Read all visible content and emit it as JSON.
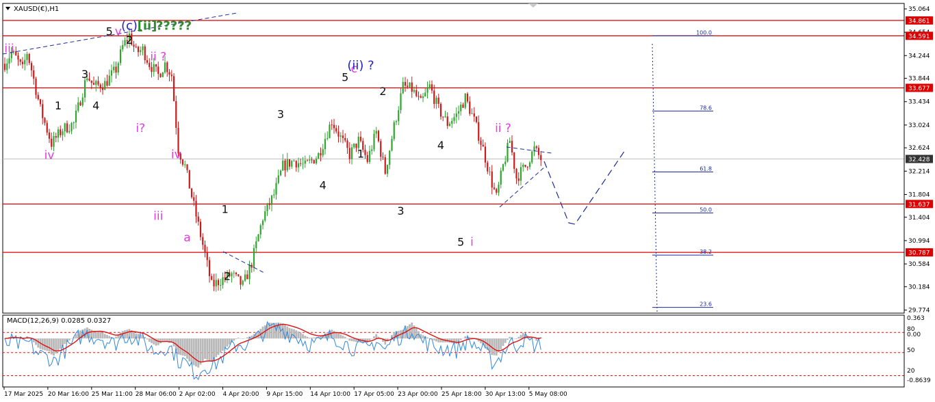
{
  "symbol_label": "XAUSD(€),H1",
  "macd_label": "MACD(12,26,9) 0.0285 0.0327",
  "colors": {
    "level_line": "#dd0000",
    "candle_up": "#2ea52e",
    "candle_down": "#cc1a1a",
    "macd_line": "#2e86de",
    "signal_line": "#dd1111",
    "histogram": "#b8b8b8",
    "projection": "#1a2a9a",
    "fib_line": "#1a2a9a",
    "price_box": "#dd0000",
    "current_box": "#333333",
    "magenta": "#e23ce2",
    "black": "#111111",
    "blue": "#2222cc",
    "green": "#2e8b2e"
  },
  "chart_data": {
    "type": "candlestick",
    "y_range": [
      29.72,
      35.16
    ],
    "price_ticks": [
      "35.064",
      "34.654",
      "34.244",
      "33.844",
      "33.434",
      "33.024",
      "32.624",
      "32.214",
      "31.804",
      "31.404",
      "30.994",
      "30.584",
      "30.184",
      "29.774"
    ],
    "price_tick_values": [
      35.064,
      34.654,
      34.244,
      33.844,
      33.434,
      33.024,
      32.624,
      32.214,
      31.804,
      31.404,
      30.994,
      30.584,
      30.184,
      29.774
    ],
    "time_labels": [
      "17 Mar 2025",
      "20 Mar 16:00",
      "25 Mar 11:00",
      "28 Mar 06:00",
      "2 Apr 02:00",
      "4 Apr 20:00",
      "9 Apr 15:00",
      "14 Apr 10:00",
      "17 Apr 05:00",
      "23 Apr 00:00",
      "25 Apr 18:00",
      "30 Apr 13:00",
      "5 May 08:00"
    ],
    "horizontal_levels": [
      {
        "label": "34.861",
        "value": 34.861
      },
      {
        "label": "34.591",
        "value": 34.591
      },
      {
        "label": "33.677",
        "value": 33.677
      },
      {
        "label": "31.637",
        "value": 31.637
      },
      {
        "label": "30.787",
        "value": 30.787
      }
    ],
    "current_price": {
      "label": "32.428",
      "value": 32.428
    },
    "price_path": [
      [
        0,
        34.1
      ],
      [
        3,
        34.3
      ],
      [
        5,
        34.2
      ],
      [
        8,
        34.0
      ],
      [
        10,
        34.3
      ],
      [
        12,
        34.0
      ],
      [
        16,
        33.3
      ],
      [
        21,
        32.7
      ],
      [
        26,
        32.95
      ],
      [
        31,
        33.05
      ],
      [
        37,
        33.9
      ],
      [
        40,
        33.7
      ],
      [
        45,
        33.75
      ],
      [
        50,
        34.0
      ],
      [
        53,
        34.4
      ],
      [
        56,
        34.6
      ],
      [
        59,
        34.3
      ],
      [
        62,
        34.35
      ],
      [
        65,
        34.1
      ],
      [
        69,
        33.9
      ],
      [
        72,
        34.1
      ],
      [
        75,
        33.9
      ],
      [
        78,
        32.6
      ],
      [
        81,
        32.3
      ],
      [
        85,
        31.6
      ],
      [
        90,
        30.75
      ],
      [
        93,
        30.2
      ],
      [
        97,
        30.3
      ],
      [
        102,
        30.4
      ],
      [
        107,
        30.2
      ],
      [
        111,
        30.6
      ],
      [
        116,
        31.4
      ],
      [
        121,
        31.8
      ],
      [
        125,
        32.3
      ],
      [
        130,
        32.4
      ],
      [
        135,
        32.3
      ],
      [
        141,
        32.5
      ],
      [
        147,
        33.1
      ],
      [
        151,
        32.8
      ],
      [
        155,
        32.5
      ],
      [
        159,
        32.75
      ],
      [
        163,
        32.4
      ],
      [
        167,
        32.9
      ],
      [
        171,
        32.2
      ],
      [
        175,
        33.0
      ],
      [
        179,
        33.7
      ],
      [
        183,
        33.65
      ],
      [
        187,
        33.4
      ],
      [
        191,
        33.7
      ],
      [
        195,
        33.3
      ],
      [
        199,
        33.05
      ],
      [
        203,
        33.2
      ],
      [
        207,
        33.5
      ],
      [
        211,
        33.1
      ],
      [
        215,
        32.6
      ],
      [
        219,
        32.0
      ],
      [
        221,
        31.75
      ],
      [
        224,
        32.3
      ],
      [
        227,
        32.75
      ],
      [
        230,
        32.1
      ],
      [
        234,
        32.3
      ],
      [
        238,
        32.6
      ],
      [
        241,
        32.43
      ]
    ],
    "macd_ticks": [
      "0.363",
      "0.00",
      "20",
      "-0.8639"
    ],
    "rsi_ticks": [
      "80",
      "50"
    ],
    "macd_range": [
      -0.95,
      0.45
    ],
    "macd_dashed_levels": [
      0.12,
      -0.28,
      -0.74
    ],
    "wave_labels": [
      {
        "text": "iii",
        "color": "magenta",
        "price": 34.3,
        "bar": 2,
        "size": 17
      },
      {
        "text": "1",
        "color": "black",
        "price": 33.3,
        "bar": 24,
        "size": 16
      },
      {
        "text": "iv",
        "color": "magenta",
        "price": 32.43,
        "bar": 20,
        "size": 17
      },
      {
        "text": "3",
        "color": "black",
        "price": 33.85,
        "bar": 36,
        "size": 16
      },
      {
        "text": "4",
        "color": "black",
        "price": 33.3,
        "bar": 41,
        "size": 16
      },
      {
        "text": "5",
        "color": "black",
        "price": 34.6,
        "bar": 47,
        "size": 16
      },
      {
        "text": "v",
        "color": "magenta",
        "price": 34.6,
        "bar": 51,
        "size": 17
      },
      {
        "text": "2",
        "color": "black",
        "price": 34.45,
        "bar": 56,
        "size": 16
      },
      {
        "text": "(c)",
        "color": "blue",
        "price": 34.7,
        "bar": 56,
        "size": 18
      },
      {
        "text": "[ii]",
        "color": "green",
        "price": 34.7,
        "bar": 64,
        "size": 18
      },
      {
        "text": "?????",
        "color": "green",
        "price": 34.7,
        "bar": 76,
        "size": 18
      },
      {
        "text": "ii ?",
        "color": "magenta",
        "price": 34.16,
        "bar": 69,
        "size": 17
      },
      {
        "text": "i?",
        "color": "magenta",
        "price": 32.9,
        "bar": 61,
        "size": 17
      },
      {
        "text": "iv",
        "color": "magenta",
        "price": 32.44,
        "bar": 77,
        "size": 17
      },
      {
        "text": "iii",
        "color": "magenta",
        "price": 31.36,
        "bar": 69,
        "size": 17
      },
      {
        "text": "a",
        "color": "magenta",
        "price": 30.98,
        "bar": 82,
        "size": 17
      },
      {
        "text": "1",
        "color": "black",
        "price": 31.48,
        "bar": 99,
        "size": 16
      },
      {
        "text": "2",
        "color": "black",
        "price": 30.3,
        "bar": 100,
        "size": 16
      },
      {
        "text": "3",
        "color": "black",
        "price": 33.15,
        "bar": 124,
        "size": 16
      },
      {
        "text": "4",
        "color": "black",
        "price": 31.9,
        "bar": 143,
        "size": 16
      },
      {
        "text": "5",
        "color": "black",
        "price": 33.8,
        "bar": 153,
        "size": 16
      },
      {
        "text": "c",
        "color": "magenta",
        "price": 33.95,
        "bar": 157,
        "size": 17
      },
      {
        "text": "(ii) ?",
        "color": "blue",
        "price": 34.0,
        "bar": 160,
        "size": 18
      },
      {
        "text": "2",
        "color": "black",
        "price": 33.55,
        "bar": 170,
        "size": 16
      },
      {
        "text": "1",
        "color": "black",
        "price": 32.45,
        "bar": 160,
        "size": 16
      },
      {
        "text": "4",
        "color": "black",
        "price": 32.6,
        "bar": 196,
        "size": 16
      },
      {
        "text": "3",
        "color": "black",
        "price": 31.45,
        "bar": 178,
        "size": 16
      },
      {
        "text": "5",
        "color": "black",
        "price": 30.9,
        "bar": 205,
        "size": 16
      },
      {
        "text": "i",
        "color": "magenta",
        "price": 30.9,
        "bar": 210,
        "size": 17
      },
      {
        "text": "ii ?",
        "color": "magenta",
        "price": 32.9,
        "bar": 224,
        "size": 17
      }
    ],
    "fibonacci": {
      "labels": [
        "100.0",
        "78.6",
        "61.8",
        "50.0",
        "38.2",
        "23.6"
      ],
      "values": [
        34.591,
        33.27,
        32.2,
        31.48,
        30.74,
        29.82
      ]
    }
  }
}
